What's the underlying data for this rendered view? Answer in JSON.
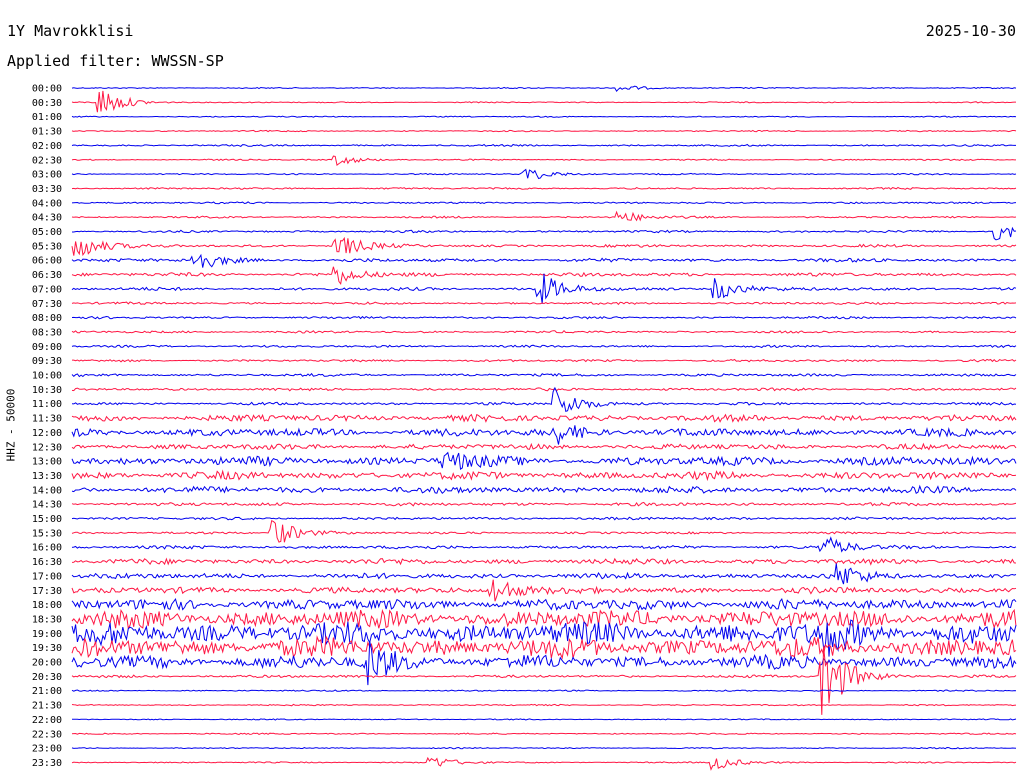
{
  "header": {
    "station": "1Y Mavrokklisi",
    "date": "2025-10-30",
    "filter_prefix": "Applied filter:",
    "filter_name": "WWSSN-SP"
  },
  "channel_label": "HHZ - 50000",
  "colors": {
    "even_trace": "#0000ee",
    "odd_trace": "#ff1744",
    "background": "#ffffff"
  },
  "chart_data": {
    "type": "line",
    "title": "",
    "ylabel": "HHZ - 50000",
    "xlabel": "",
    "grid": false,
    "legend": "none",
    "rows": [
      "00:00",
      "00:30",
      "01:00",
      "01:30",
      "02:00",
      "02:30",
      "03:00",
      "03:30",
      "04:00",
      "04:30",
      "05:00",
      "05:30",
      "06:00",
      "06:30",
      "07:00",
      "07:30",
      "08:00",
      "08:30",
      "09:00",
      "09:30",
      "10:00",
      "10:30",
      "11:00",
      "11:30",
      "12:00",
      "12:30",
      "13:00",
      "13:30",
      "14:00",
      "14:30",
      "15:00",
      "15:30",
      "16:00",
      "16:30",
      "17:00",
      "17:30",
      "18:00",
      "18:30",
      "19:00",
      "19:30",
      "20:00",
      "20:30",
      "21:00",
      "21:30",
      "22:00",
      "22:30",
      "23:00",
      "23:30"
    ],
    "row_minutes": 30,
    "noise_amplitude": [
      0.5,
      0.5,
      0.5,
      0.6,
      0.8,
      0.6,
      0.6,
      0.8,
      0.8,
      0.8,
      1.0,
      1.2,
      1.6,
      1.6,
      1.4,
      1.0,
      1.0,
      1.0,
      1.0,
      1.0,
      1.2,
      1.2,
      1.2,
      3.0,
      3.5,
      2.5,
      4.0,
      3.5,
      3.0,
      1.5,
      1.2,
      1.0,
      1.5,
      2.5,
      2.5,
      2.8,
      5.0,
      8.0,
      10.0,
      9.0,
      6.0,
      1.2,
      0.6,
      0.6,
      0.5,
      0.6,
      0.5,
      0.6
    ],
    "events": [
      {
        "row": "00:30",
        "minute": 1.0,
        "amplitude": 14
      },
      {
        "row": "00:00",
        "minute": 17.5,
        "amplitude": 3
      },
      {
        "row": "02:30",
        "minute": 8.5,
        "amplitude": 5
      },
      {
        "row": "03:00",
        "minute": 14.5,
        "amplitude": 7
      },
      {
        "row": "04:30",
        "minute": 17.5,
        "amplitude": 6
      },
      {
        "row": "05:00",
        "minute": 29.5,
        "amplitude": 9
      },
      {
        "row": "05:30",
        "minute": 0.3,
        "amplitude": 12
      },
      {
        "row": "05:30",
        "minute": 8.5,
        "amplitude": 12
      },
      {
        "row": "06:00",
        "minute": 4.0,
        "amplitude": 10
      },
      {
        "row": "06:30",
        "minute": 8.5,
        "amplitude": 9
      },
      {
        "row": "07:00",
        "minute": 15.0,
        "amplitude": 14
      },
      {
        "row": "07:00",
        "minute": 20.5,
        "amplitude": 12
      },
      {
        "row": "11:00",
        "minute": 15.5,
        "amplitude": 16
      },
      {
        "row": "12:00",
        "minute": 15.5,
        "amplitude": 9
      },
      {
        "row": "13:00",
        "minute": 12.0,
        "amplitude": 9
      },
      {
        "row": "15:30",
        "minute": 6.5,
        "amplitude": 14
      },
      {
        "row": "16:00",
        "minute": 24.0,
        "amplitude": 10
      },
      {
        "row": "17:00",
        "minute": 24.5,
        "amplitude": 10
      },
      {
        "row": "17:30",
        "minute": 13.5,
        "amplitude": 14
      },
      {
        "row": "19:00",
        "minute": 24.0,
        "amplitude": 14
      },
      {
        "row": "20:00",
        "minute": 9.5,
        "amplitude": 20
      },
      {
        "row": "20:30",
        "minute": 24.0,
        "amplitude": 38
      },
      {
        "row": "23:30",
        "minute": 11.5,
        "amplitude": 6
      },
      {
        "row": "23:30",
        "minute": 20.5,
        "amplitude": 7
      }
    ]
  }
}
